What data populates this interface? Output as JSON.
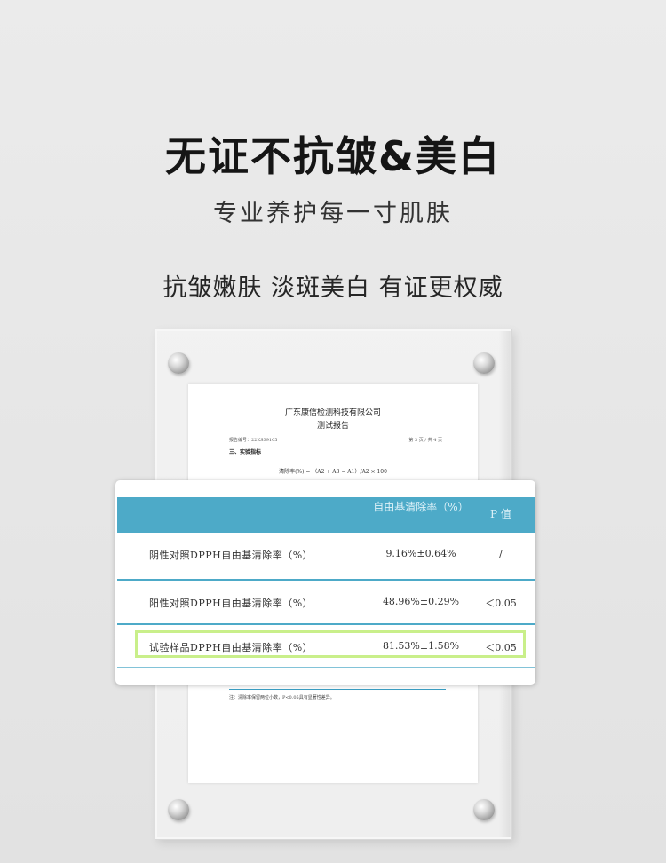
{
  "header": {
    "title": "无证不抗皱&美白",
    "subtitle": "专业养护每一寸肌肤",
    "tagline": "抗皱嫩肤 淡斑美白 有证更权威"
  },
  "document": {
    "company": "广东康信检测科技有限公司",
    "report_title": "测试报告",
    "report_no": "报告编号：22KS39105",
    "page_info": "第 3 页 / 共 4 页",
    "section": "三、实验指标",
    "formula": "清除率(%) = （A2 + A3 − A1）/A2 × 100",
    "note": "注：清除率保留两位小数，P<0.05具有显著性差异。"
  },
  "table": {
    "headers": {
      "rate": "自由基清除率（%）",
      "p": "P 值"
    },
    "rows": [
      {
        "name": "阴性对照DPPH自由基清除率（%）",
        "value": "9.16%±0.64%",
        "p": "/"
      },
      {
        "name": "阳性对照DPPH自由基清除率（%）",
        "value": "48.96%±0.29%",
        "p": "＜0.05"
      },
      {
        "name": "试验样品DPPH自由基清除率（%）",
        "value": "81.53%±1.58%",
        "p": "＜0.05"
      }
    ],
    "highlight_color": "#c9ef8a",
    "header_color": "#4daac8"
  }
}
